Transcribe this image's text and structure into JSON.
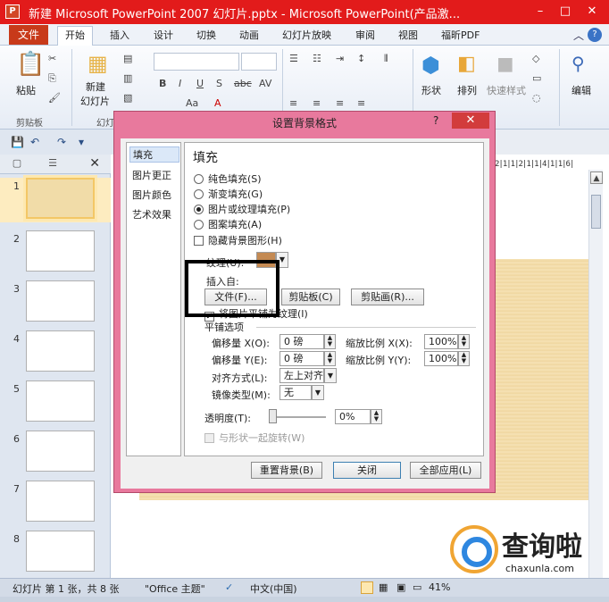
{
  "window": {
    "title": "新建 Microsoft PowerPoint 2007 幻灯片.pptx - Microsoft PowerPoint(产品激...",
    "app_icon": "P",
    "controls": [
      "–",
      "□",
      "✕"
    ]
  },
  "menu": {
    "file": "文件",
    "tabs": [
      "开始",
      "插入",
      "设计",
      "切换",
      "动画",
      "幻灯片放映",
      "审阅",
      "视图",
      "福昕PDF"
    ],
    "active_tab": "开始"
  },
  "ribbon": {
    "paste": "粘贴",
    "new_slide": "新建\n幻灯片",
    "new_slide_l1": "新建",
    "new_slide_l2": "幻灯片",
    "clipboard_group": "剪贴板",
    "slides_group_partial": "幻灯",
    "font_buttons": [
      "B",
      "I",
      "U",
      "S",
      "abc",
      "AV",
      "Aa",
      "A"
    ],
    "shape": "形状",
    "arrange": "排列",
    "quick_styles": "快速样式",
    "edit": "编辑"
  },
  "slides_panel": {
    "tab_icons": [
      "slides-tab",
      "outline-tab"
    ],
    "thumbnails": [
      "1",
      "2",
      "3",
      "4",
      "5",
      "6",
      "7",
      "8"
    ],
    "selected": "1"
  },
  "ruler_text": "2|1|1|2|1|1|4|1|1|6|",
  "dialog": {
    "title": "设置背景格式",
    "help": "?",
    "close": "✕",
    "categories": [
      "填充",
      "图片更正",
      "图片颜色",
      "艺术效果"
    ],
    "section": "填充",
    "fill_options": [
      {
        "label": "纯色填充(S)",
        "checked": false
      },
      {
        "label": "渐变填充(G)",
        "checked": false
      },
      {
        "label": "图片或纹理填充(P)",
        "checked": true
      },
      {
        "label": "图案填充(A)",
        "checked": false
      }
    ],
    "hide_bg": "隐藏背景图形(H)",
    "texture_label": "纹理(U):",
    "insert_from": "插入自:",
    "file_btn": "文件(F)...",
    "clipboard_btn": "剪贴板(C)",
    "clipart_btn": "剪贴画(R)...",
    "tile_check": "将图片平铺为纹理(I)",
    "tile_options": "平铺选项",
    "offset_x_label": "偏移量 X(O):",
    "offset_x_value": "0 磅",
    "offset_y_label": "偏移量 Y(E):",
    "offset_y_value": "0 磅",
    "scale_x_label": "缩放比例 X(X):",
    "scale_x_value": "100%",
    "scale_y_label": "缩放比例 Y(Y):",
    "scale_y_value": "100%",
    "align_label": "对齐方式(L):",
    "align_value": "左上对齐",
    "mirror_label": "镜像类型(M):",
    "mirror_value": "无",
    "transparency_label": "透明度(T):",
    "transparency_value": "0%",
    "transparency_level": 0,
    "rotate_with_shape": "与形状一起旋转(W)",
    "reset_btn": "重置背景(B)",
    "close_btn": "关闭",
    "apply_all_btn": "全部应用(L)"
  },
  "status": {
    "slide_info": "幻灯片 第 1 张，共 8 张",
    "theme": "\"Office 主题\"",
    "language": "中文(中国)",
    "zoom": "41%"
  },
  "watermark": {
    "text": "查询啦",
    "url": "chaxunla.com"
  }
}
